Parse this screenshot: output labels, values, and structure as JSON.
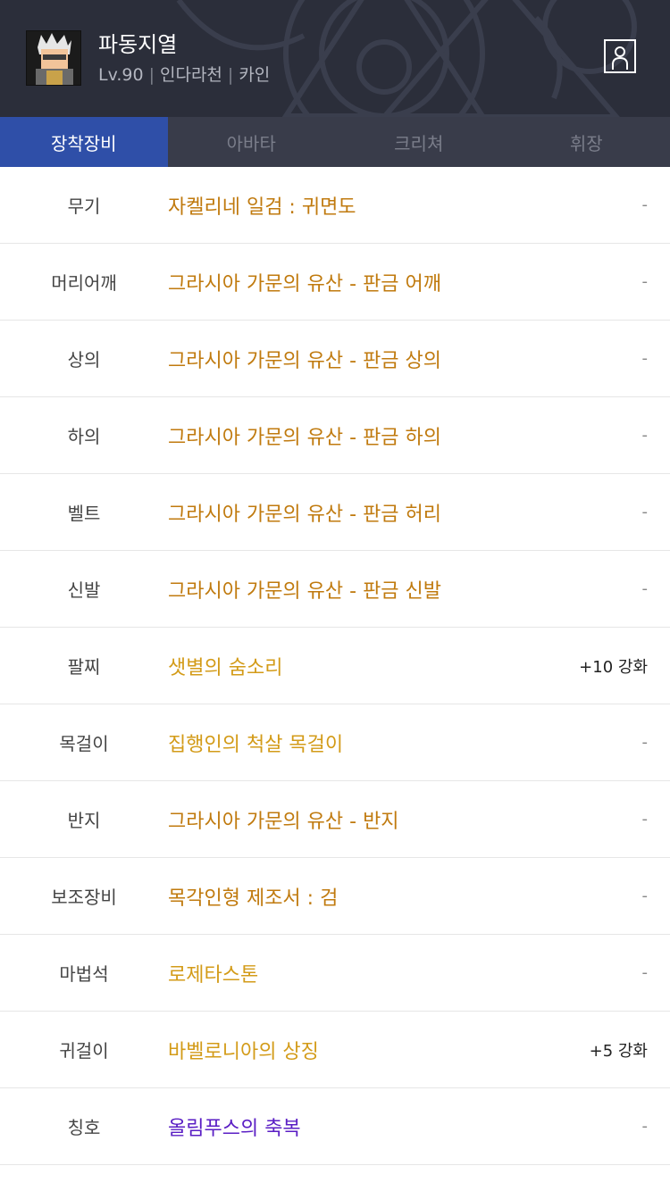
{
  "character": {
    "name": "파동지열",
    "level": "Lv.90",
    "server": "인다라천",
    "guild": "카인"
  },
  "tabs": [
    {
      "label": "장착장비",
      "active": true
    },
    {
      "label": "아바타",
      "active": false
    },
    {
      "label": "크리쳐",
      "active": false
    },
    {
      "label": "휘장",
      "active": false
    }
  ],
  "rarity_colors": {
    "epic": "#c07a0e",
    "unique": "#d39b18",
    "legendary": "#5a1ec4"
  },
  "equipment": [
    {
      "slot": "무기",
      "item": "자켈리네 일검 : 귀면도",
      "rarity": "epic",
      "enhance": "-"
    },
    {
      "slot": "머리어깨",
      "item": "그라시아 가문의 유산 - 판금 어깨",
      "rarity": "epic",
      "enhance": "-"
    },
    {
      "slot": "상의",
      "item": "그라시아 가문의 유산 - 판금 상의",
      "rarity": "epic",
      "enhance": "-"
    },
    {
      "slot": "하의",
      "item": "그라시아 가문의 유산 - 판금 하의",
      "rarity": "epic",
      "enhance": "-"
    },
    {
      "slot": "벨트",
      "item": "그라시아 가문의 유산 - 판금 허리",
      "rarity": "epic",
      "enhance": "-"
    },
    {
      "slot": "신발",
      "item": "그라시아 가문의 유산 - 판금 신발",
      "rarity": "epic",
      "enhance": "-"
    },
    {
      "slot": "팔찌",
      "item": "샛별의 숨소리",
      "rarity": "unique",
      "enhance": "+10 강화"
    },
    {
      "slot": "목걸이",
      "item": "집행인의 척살 목걸이",
      "rarity": "unique",
      "enhance": "-"
    },
    {
      "slot": "반지",
      "item": "그라시아 가문의 유산 - 반지",
      "rarity": "epic",
      "enhance": "-"
    },
    {
      "slot": "보조장비",
      "item": "목각인형 제조서 : 검",
      "rarity": "epic",
      "enhance": "-"
    },
    {
      "slot": "마법석",
      "item": "로제타스톤",
      "rarity": "unique",
      "enhance": "-"
    },
    {
      "slot": "귀걸이",
      "item": "바벨로니아의 상징",
      "rarity": "unique",
      "enhance": "+5 강화"
    },
    {
      "slot": "칭호",
      "item": "올림푸스의 축복",
      "rarity": "legendary",
      "enhance": "-"
    }
  ]
}
